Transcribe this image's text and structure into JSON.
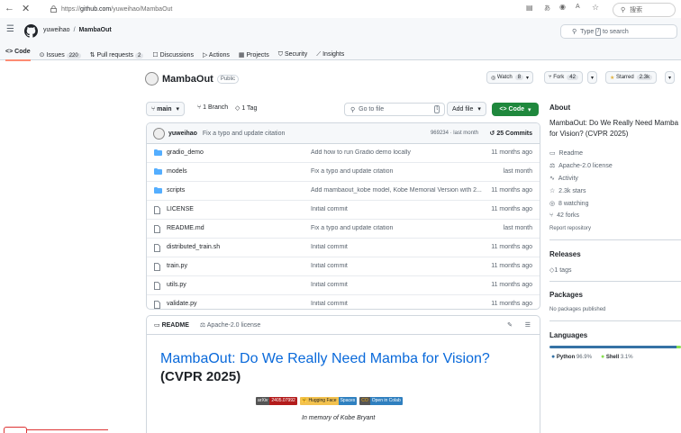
{
  "browser": {
    "url_prefix": "https://",
    "url_host": "github.com",
    "url_path": "/yuweihao/MambaOut",
    "search_label": "搜索"
  },
  "header": {
    "owner": "yuweihao",
    "separator": "/",
    "repo": "MambaOut",
    "search_type": "Type",
    "search_key": "/",
    "search_rest": "to search"
  },
  "tabs": [
    {
      "label": "Code",
      "count": ""
    },
    {
      "label": "Issues",
      "count": "220"
    },
    {
      "label": "Pull requests",
      "count": "2"
    },
    {
      "label": "Discussions",
      "count": ""
    },
    {
      "label": "Actions",
      "count": ""
    },
    {
      "label": "Projects",
      "count": ""
    },
    {
      "label": "Security",
      "count": ""
    },
    {
      "label": "Insights",
      "count": ""
    }
  ],
  "repo": {
    "name": "MambaOut",
    "visibility": "Public",
    "watch_label": "Watch",
    "watch_count": "8",
    "fork_label": "Fork",
    "fork_count": "42",
    "star_label": "Starred",
    "star_count": "2.3k"
  },
  "toolbar": {
    "branch": "main",
    "branches": "1 Branch",
    "tags": "1 Tag",
    "goto": "Go to file",
    "goto_key": "t",
    "add_file": "Add file",
    "code": "Code"
  },
  "commit": {
    "author": "yuweihao",
    "message": "Fix a typo and update citation",
    "hash": "969234 · last month",
    "commits": "25 Commits"
  },
  "files": [
    {
      "type": "dir",
      "name": "gradio_demo",
      "message": "Add how to run Gradio demo locally",
      "time": "11 months ago"
    },
    {
      "type": "dir",
      "name": "models",
      "message": "Fix a typo and update citation",
      "time": "last month"
    },
    {
      "type": "dir",
      "name": "scripts",
      "message": "Add mambaout_kobe model, Kobe Memorial Version with 2...",
      "time": "11 months ago"
    },
    {
      "type": "file",
      "name": "LICENSE",
      "message": "Initial commit",
      "time": "11 months ago"
    },
    {
      "type": "file",
      "name": "README.md",
      "message": "Fix a typo and update citation",
      "time": "last month"
    },
    {
      "type": "file",
      "name": "distributed_train.sh",
      "message": "Initial commit",
      "time": "11 months ago"
    },
    {
      "type": "file",
      "name": "train.py",
      "message": "Initial commit",
      "time": "11 months ago"
    },
    {
      "type": "file",
      "name": "utils.py",
      "message": "Initial commit",
      "time": "11 months ago"
    },
    {
      "type": "file",
      "name": "validate.py",
      "message": "Initial commit",
      "time": "11 months ago"
    }
  ],
  "readme": {
    "tab_readme": "README",
    "tab_license": "Apache-2.0 license",
    "title": "MambaOut: Do We Really Need Mamba for Vision?",
    "subtitle": "(CVPR 2025)",
    "badges": [
      {
        "left": "arXiv",
        "right": "2405.07992",
        "left_color": "#555555",
        "right_color": "#b31b1b"
      },
      {
        "left": "🤗 Hugging Face",
        "right": "Spaces",
        "left_color": "#3c3c3c",
        "right_color": "#2f80c0",
        "left_bg": "#f2c14e"
      },
      {
        "left": "CO",
        "right": "Open in Colab",
        "left_color": "#f9ab00",
        "right_color": "#2f7fbf"
      }
    ],
    "memory": "In memory of Kobe Bryant"
  },
  "about": {
    "heading": "About",
    "description": "MambaOut: Do We Really Need Mamba for Vision? (CVPR 2025)",
    "readme": "Readme",
    "license": "Apache-2.0 license",
    "activity": "Activity",
    "stars": "2.3k stars",
    "watching": "8 watching",
    "forks": "42 forks",
    "report": "Report repository"
  },
  "releases": {
    "heading": "Releases",
    "tags": "1 tags"
  },
  "packages": {
    "heading": "Packages",
    "none": "No packages published"
  },
  "languages": {
    "heading": "Languages",
    "items": [
      {
        "name": "Python",
        "percent": "96.9%",
        "value": 96.9,
        "color": "#3572A5"
      },
      {
        "name": "Shell",
        "percent": "3.1%",
        "value": 3.1,
        "color": "#89e051"
      }
    ]
  }
}
